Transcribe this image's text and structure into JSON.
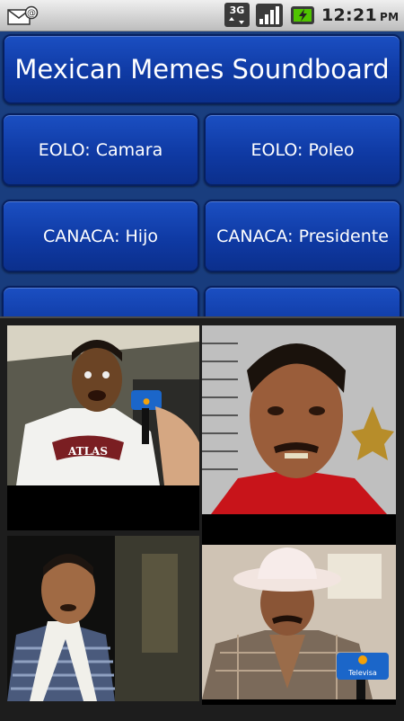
{
  "status_bar": {
    "network": "3G",
    "time": "12:21",
    "ampm": "PM"
  },
  "app": {
    "title": "Mexican Memes Soundboard",
    "buttons": [
      {
        "label": "EOLO: Camara"
      },
      {
        "label": "EOLO: Poleo"
      },
      {
        "label": "CANACA: Hijo"
      },
      {
        "label": "CANACA: Presidente"
      },
      {
        "label": ""
      },
      {
        "label": ""
      }
    ]
  },
  "overlay": {
    "photos": [
      {
        "name": "photo-eolo",
        "caption_text": "ATLAS"
      },
      {
        "name": "photo-mugshot"
      },
      {
        "name": "photo-man-scarf"
      },
      {
        "name": "photo-canaca-hat",
        "logo_text": "Televisa"
      }
    ]
  },
  "colors": {
    "button_blue": "#1246b8",
    "background_blue": "#183c7d",
    "status_bar": "#d9d9d9"
  }
}
